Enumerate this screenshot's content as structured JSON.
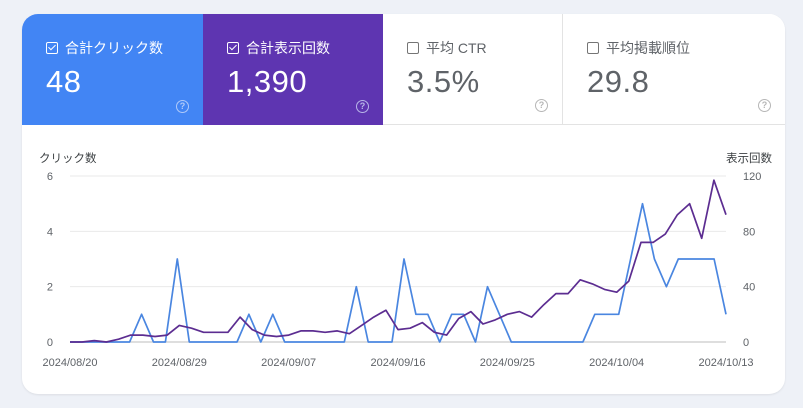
{
  "metrics": [
    {
      "label": "合計クリック数",
      "value": "48",
      "checked": true
    },
    {
      "label": "合計表示回数",
      "value": "1,390",
      "checked": true
    },
    {
      "label": "平均 CTR",
      "value": "3.5%",
      "checked": false
    },
    {
      "label": "平均掲載順位",
      "value": "29.8",
      "checked": false
    }
  ],
  "help_icon_glyph": "?",
  "chart_data": {
    "type": "line",
    "ylabel_left": "クリック数",
    "ylabel_right": "表示回数",
    "left_ticks": [
      "6",
      "4",
      "2",
      "0"
    ],
    "right_ticks": [
      "120",
      "80",
      "40",
      "0"
    ],
    "x_tick_labels": [
      "2024/08/20",
      "2024/08/29",
      "2024/09/07",
      "2024/09/16",
      "2024/09/25",
      "2024/10/04",
      "2024/10/13"
    ],
    "ylim_left": [
      0,
      6
    ],
    "ylim_right": [
      0,
      120
    ],
    "grid": true,
    "colors": {
      "clicks": "#4a86e0",
      "impressions": "#5c2d91",
      "grid": "#e9e9e9"
    },
    "series": [
      {
        "name": "クリック数",
        "axis": "left",
        "color": "#4a86e0",
        "values": [
          0,
          0,
          0,
          0,
          0,
          0,
          1,
          0,
          0,
          3,
          0,
          0,
          0,
          0,
          0,
          1,
          0,
          1,
          0,
          0,
          0,
          0,
          0,
          0,
          2,
          0,
          0,
          0,
          3,
          1,
          1,
          0,
          1,
          1,
          0,
          2,
          1,
          0,
          0,
          0,
          0,
          0,
          0,
          0,
          1,
          1,
          1,
          3,
          5,
          3,
          2,
          3,
          3,
          3,
          3,
          1
        ]
      },
      {
        "name": "表示回数",
        "axis": "right",
        "color": "#5c2d91",
        "values": [
          0,
          0,
          1,
          0,
          2,
          5,
          5,
          4,
          5,
          12,
          10,
          7,
          7,
          7,
          18,
          9,
          5,
          4,
          5,
          8,
          8,
          7,
          8,
          6,
          12,
          18,
          23,
          9,
          10,
          14,
          7,
          5,
          17,
          22,
          13,
          16,
          20,
          22,
          18,
          27,
          35,
          35,
          45,
          42,
          38,
          36,
          44,
          72,
          72,
          78,
          92,
          100,
          75,
          117,
          92
        ]
      }
    ]
  }
}
